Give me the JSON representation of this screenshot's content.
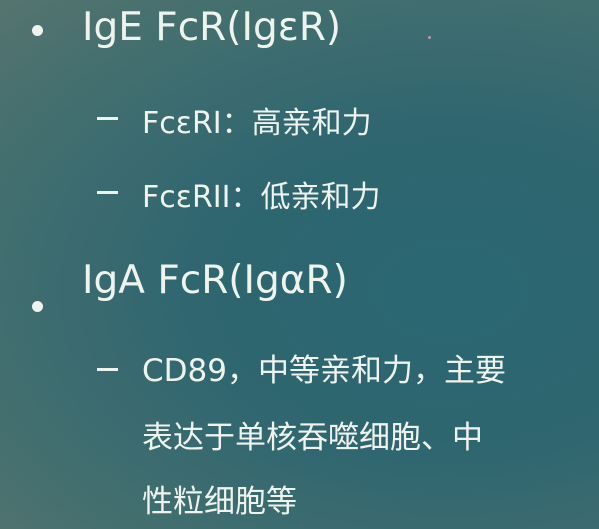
{
  "slide": {
    "items": [
      {
        "text": "IgE FcR(IgεR)",
        "sub": [
          {
            "text": "FcεRI：高亲和力"
          },
          {
            "text": "FcεRII：低亲和力"
          }
        ]
      },
      {
        "text": "IgA FcR(IgαR)",
        "sub": [
          {
            "lines": [
              "CD89，中等亲和力，主要",
              "表达于单核吞噬细胞、中",
              "性粒细胞等"
            ]
          }
        ]
      }
    ]
  }
}
